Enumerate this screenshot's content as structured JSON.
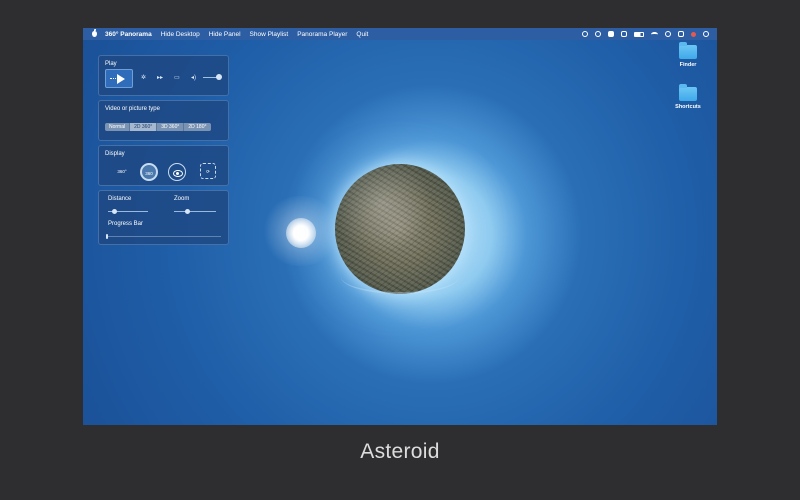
{
  "menubar": {
    "app_name": "360° Panorama",
    "items": [
      "Hide Desktop",
      "Hide Panel",
      "Show Playlist",
      "Panorama Player",
      "Quit"
    ]
  },
  "desktop": {
    "icons": [
      {
        "label": "Finder",
        "icon": "folder-icon"
      },
      {
        "label": "Shortcuts",
        "icon": "folder-icon"
      }
    ]
  },
  "panel": {
    "play": {
      "title": "Play",
      "controls": [
        "play-icon",
        "gear-icon",
        "fast-forward-icon",
        "folder-icon",
        "volume-icon"
      ]
    },
    "type": {
      "title": "Video or picture type",
      "options": [
        "Normal",
        "2D 360°",
        "3D 360°",
        "2D 180°"
      ],
      "selected": "2D 360°"
    },
    "display": {
      "title": "Display",
      "icon_a": "360°",
      "icon_b": "360"
    },
    "sliders": {
      "distance_label": "Distance",
      "zoom_label": "Zoom",
      "progress_label": "Progress Bar",
      "distance_value": 0.15,
      "zoom_value": 0.3,
      "progress_value": 0.0
    }
  },
  "caption": "Asteroid",
  "colors": {
    "page_background": "#2e2e30",
    "menubar": "#2d5ea3",
    "panel": "#1f4882",
    "accent": "#2f6cb9"
  }
}
